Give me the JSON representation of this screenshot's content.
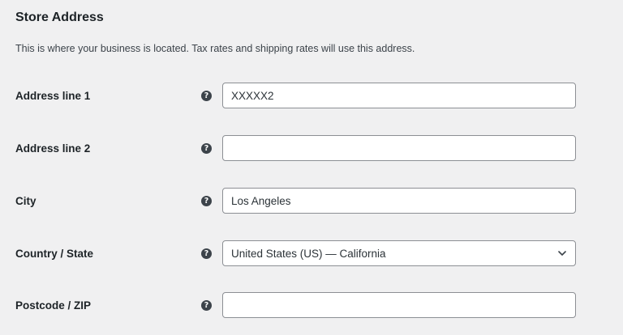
{
  "section": {
    "title": "Store Address",
    "description": "This is where your business is located. Tax rates and shipping rates will use this address."
  },
  "fields": {
    "address_1": {
      "label": "Address line 1",
      "value": "XXXXX2",
      "help_icon": "question-circle-icon"
    },
    "address_2": {
      "label": "Address line 2",
      "value": "",
      "help_icon": "question-circle-icon"
    },
    "city": {
      "label": "City",
      "value": "Los Angeles",
      "help_icon": "question-circle-icon"
    },
    "country_state": {
      "label": "Country / State",
      "value": "United States (US) — California",
      "help_icon": "question-circle-icon",
      "dropdown_icon": "chevron-down-icon"
    },
    "postcode": {
      "label": "Postcode / ZIP",
      "value": "",
      "help_icon": "question-circle-icon"
    }
  },
  "help_glyph": "?",
  "colors": {
    "background": "#f0f0f1",
    "text": "#1d2327",
    "border": "#8c8f94",
    "help_icon": "#3c434a"
  }
}
